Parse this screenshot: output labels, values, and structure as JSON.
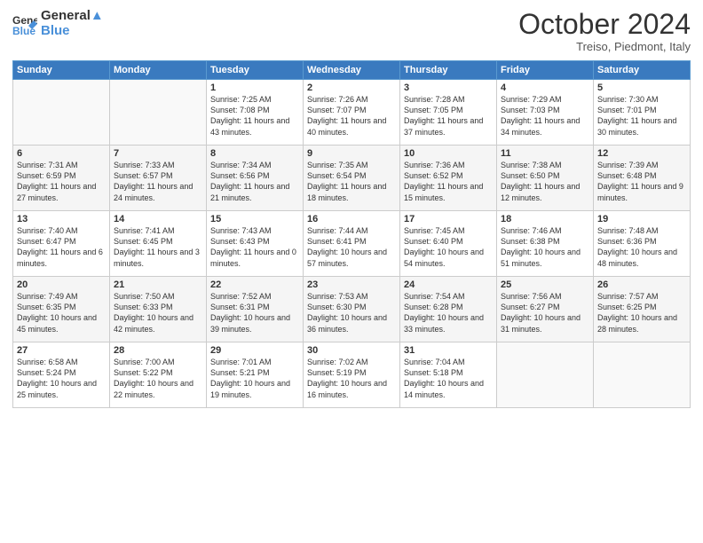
{
  "header": {
    "logo_line1": "General",
    "logo_line2": "Blue",
    "month": "October 2024",
    "location": "Treiso, Piedmont, Italy"
  },
  "weekdays": [
    "Sunday",
    "Monday",
    "Tuesday",
    "Wednesday",
    "Thursday",
    "Friday",
    "Saturday"
  ],
  "weeks": [
    [
      {
        "day": "",
        "sunrise": "",
        "sunset": "",
        "daylight": ""
      },
      {
        "day": "",
        "sunrise": "",
        "sunset": "",
        "daylight": ""
      },
      {
        "day": "1",
        "sunrise": "Sunrise: 7:25 AM",
        "sunset": "Sunset: 7:08 PM",
        "daylight": "Daylight: 11 hours and 43 minutes."
      },
      {
        "day": "2",
        "sunrise": "Sunrise: 7:26 AM",
        "sunset": "Sunset: 7:07 PM",
        "daylight": "Daylight: 11 hours and 40 minutes."
      },
      {
        "day": "3",
        "sunrise": "Sunrise: 7:28 AM",
        "sunset": "Sunset: 7:05 PM",
        "daylight": "Daylight: 11 hours and 37 minutes."
      },
      {
        "day": "4",
        "sunrise": "Sunrise: 7:29 AM",
        "sunset": "Sunset: 7:03 PM",
        "daylight": "Daylight: 11 hours and 34 minutes."
      },
      {
        "day": "5",
        "sunrise": "Sunrise: 7:30 AM",
        "sunset": "Sunset: 7:01 PM",
        "daylight": "Daylight: 11 hours and 30 minutes."
      }
    ],
    [
      {
        "day": "6",
        "sunrise": "Sunrise: 7:31 AM",
        "sunset": "Sunset: 6:59 PM",
        "daylight": "Daylight: 11 hours and 27 minutes."
      },
      {
        "day": "7",
        "sunrise": "Sunrise: 7:33 AM",
        "sunset": "Sunset: 6:57 PM",
        "daylight": "Daylight: 11 hours and 24 minutes."
      },
      {
        "day": "8",
        "sunrise": "Sunrise: 7:34 AM",
        "sunset": "Sunset: 6:56 PM",
        "daylight": "Daylight: 11 hours and 21 minutes."
      },
      {
        "day": "9",
        "sunrise": "Sunrise: 7:35 AM",
        "sunset": "Sunset: 6:54 PM",
        "daylight": "Daylight: 11 hours and 18 minutes."
      },
      {
        "day": "10",
        "sunrise": "Sunrise: 7:36 AM",
        "sunset": "Sunset: 6:52 PM",
        "daylight": "Daylight: 11 hours and 15 minutes."
      },
      {
        "day": "11",
        "sunrise": "Sunrise: 7:38 AM",
        "sunset": "Sunset: 6:50 PM",
        "daylight": "Daylight: 11 hours and 12 minutes."
      },
      {
        "day": "12",
        "sunrise": "Sunrise: 7:39 AM",
        "sunset": "Sunset: 6:48 PM",
        "daylight": "Daylight: 11 hours and 9 minutes."
      }
    ],
    [
      {
        "day": "13",
        "sunrise": "Sunrise: 7:40 AM",
        "sunset": "Sunset: 6:47 PM",
        "daylight": "Daylight: 11 hours and 6 minutes."
      },
      {
        "day": "14",
        "sunrise": "Sunrise: 7:41 AM",
        "sunset": "Sunset: 6:45 PM",
        "daylight": "Daylight: 11 hours and 3 minutes."
      },
      {
        "day": "15",
        "sunrise": "Sunrise: 7:43 AM",
        "sunset": "Sunset: 6:43 PM",
        "daylight": "Daylight: 11 hours and 0 minutes."
      },
      {
        "day": "16",
        "sunrise": "Sunrise: 7:44 AM",
        "sunset": "Sunset: 6:41 PM",
        "daylight": "Daylight: 10 hours and 57 minutes."
      },
      {
        "day": "17",
        "sunrise": "Sunrise: 7:45 AM",
        "sunset": "Sunset: 6:40 PM",
        "daylight": "Daylight: 10 hours and 54 minutes."
      },
      {
        "day": "18",
        "sunrise": "Sunrise: 7:46 AM",
        "sunset": "Sunset: 6:38 PM",
        "daylight": "Daylight: 10 hours and 51 minutes."
      },
      {
        "day": "19",
        "sunrise": "Sunrise: 7:48 AM",
        "sunset": "Sunset: 6:36 PM",
        "daylight": "Daylight: 10 hours and 48 minutes."
      }
    ],
    [
      {
        "day": "20",
        "sunrise": "Sunrise: 7:49 AM",
        "sunset": "Sunset: 6:35 PM",
        "daylight": "Daylight: 10 hours and 45 minutes."
      },
      {
        "day": "21",
        "sunrise": "Sunrise: 7:50 AM",
        "sunset": "Sunset: 6:33 PM",
        "daylight": "Daylight: 10 hours and 42 minutes."
      },
      {
        "day": "22",
        "sunrise": "Sunrise: 7:52 AM",
        "sunset": "Sunset: 6:31 PM",
        "daylight": "Daylight: 10 hours and 39 minutes."
      },
      {
        "day": "23",
        "sunrise": "Sunrise: 7:53 AM",
        "sunset": "Sunset: 6:30 PM",
        "daylight": "Daylight: 10 hours and 36 minutes."
      },
      {
        "day": "24",
        "sunrise": "Sunrise: 7:54 AM",
        "sunset": "Sunset: 6:28 PM",
        "daylight": "Daylight: 10 hours and 33 minutes."
      },
      {
        "day": "25",
        "sunrise": "Sunrise: 7:56 AM",
        "sunset": "Sunset: 6:27 PM",
        "daylight": "Daylight: 10 hours and 31 minutes."
      },
      {
        "day": "26",
        "sunrise": "Sunrise: 7:57 AM",
        "sunset": "Sunset: 6:25 PM",
        "daylight": "Daylight: 10 hours and 28 minutes."
      }
    ],
    [
      {
        "day": "27",
        "sunrise": "Sunrise: 6:58 AM",
        "sunset": "Sunset: 5:24 PM",
        "daylight": "Daylight: 10 hours and 25 minutes."
      },
      {
        "day": "28",
        "sunrise": "Sunrise: 7:00 AM",
        "sunset": "Sunset: 5:22 PM",
        "daylight": "Daylight: 10 hours and 22 minutes."
      },
      {
        "day": "29",
        "sunrise": "Sunrise: 7:01 AM",
        "sunset": "Sunset: 5:21 PM",
        "daylight": "Daylight: 10 hours and 19 minutes."
      },
      {
        "day": "30",
        "sunrise": "Sunrise: 7:02 AM",
        "sunset": "Sunset: 5:19 PM",
        "daylight": "Daylight: 10 hours and 16 minutes."
      },
      {
        "day": "31",
        "sunrise": "Sunrise: 7:04 AM",
        "sunset": "Sunset: 5:18 PM",
        "daylight": "Daylight: 10 hours and 14 minutes."
      },
      {
        "day": "",
        "sunrise": "",
        "sunset": "",
        "daylight": ""
      },
      {
        "day": "",
        "sunrise": "",
        "sunset": "",
        "daylight": ""
      }
    ]
  ]
}
